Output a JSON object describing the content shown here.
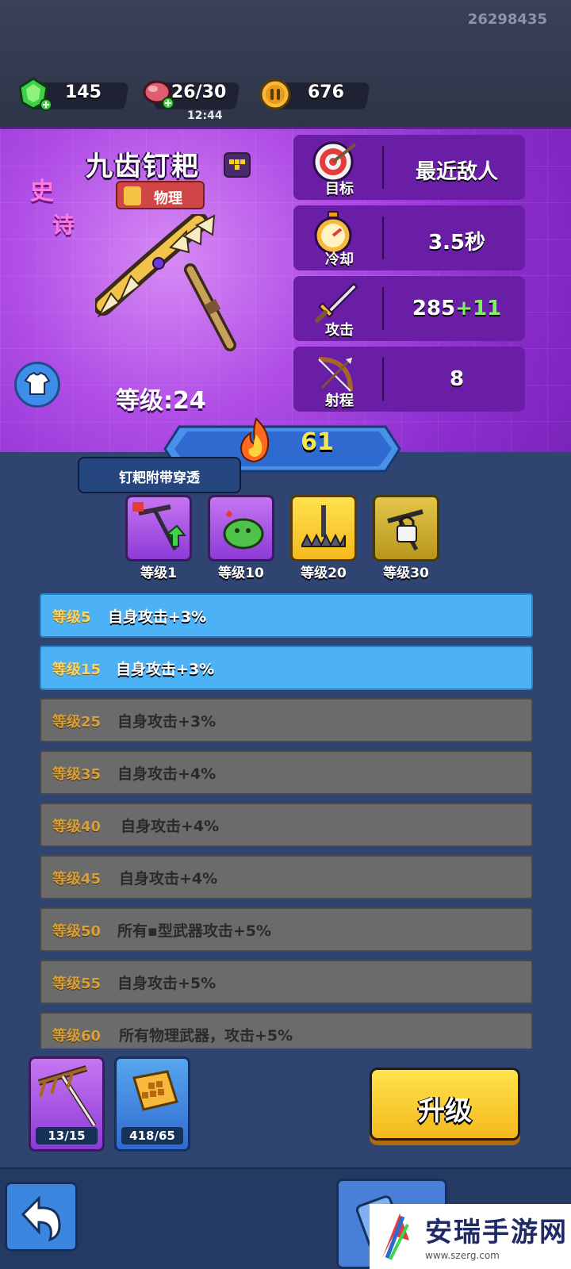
{
  "header": {
    "user_id": "26298435",
    "gems": "145",
    "energy": "26/30",
    "energy_timer": "12:44",
    "coins": "676"
  },
  "weapon": {
    "name": "九齿钉耙",
    "damage_type": "物理",
    "rarity_line1": "史",
    "rarity_line2": "诗",
    "level_text": "等级:24"
  },
  "stats": [
    {
      "label": "目标",
      "value": "最近敌人",
      "icon": "target-icon"
    },
    {
      "label": "冷却",
      "value": "3.5秒",
      "icon": "stopwatch-icon"
    },
    {
      "label": "攻击",
      "value": "285",
      "bonus": "+11",
      "icon": "sword-icon"
    },
    {
      "label": "射程",
      "value": "8",
      "icon": "bow-icon"
    }
  ],
  "power": "61",
  "tooltip": "钉耙附带穿透",
  "skills": [
    {
      "label": "等级1",
      "icon": "rake-pierce-icon"
    },
    {
      "label": "等级10",
      "icon": "slime-icon"
    },
    {
      "label": "等级20",
      "icon": "spike-trap-icon"
    },
    {
      "label": "等级30",
      "icon": "locked-weapon-icon"
    }
  ],
  "level_rows": [
    {
      "level": "等级5",
      "desc": "自身攻击+3%",
      "unlocked": true
    },
    {
      "level": "等级15",
      "desc": "自身攻击+3%",
      "unlocked": true
    },
    {
      "level": "等级25",
      "desc": "自身攻击+3%",
      "unlocked": false
    },
    {
      "level": "等级35",
      "desc": "自身攻击+4%",
      "unlocked": false
    },
    {
      "level": "等级40",
      "desc": "自身攻击+4%",
      "unlocked": false
    },
    {
      "level": "等级45",
      "desc": "自身攻击+4%",
      "unlocked": false
    },
    {
      "level": "等级50",
      "desc": "所有▪型武器攻击+5%",
      "unlocked": false
    },
    {
      "level": "等级55",
      "desc": "自身攻击+5%",
      "unlocked": false
    },
    {
      "level": "等级60",
      "desc": "所有物理武器，攻击+5%",
      "unlocked": false
    }
  ],
  "cards": {
    "weapon_shards": "13/15",
    "material": "418/65"
  },
  "upgrade_button": "升级",
  "ad": {
    "title": "安瑞手游网",
    "url": "www.szerg.com"
  },
  "colors": {
    "epic_purple": "#8e2fd0",
    "unlocked_row": "#4cb1f5",
    "locked_row": "#6b6b6b",
    "bonus_green": "#7cf45f",
    "upgrade_yellow": "#ffd23a"
  }
}
